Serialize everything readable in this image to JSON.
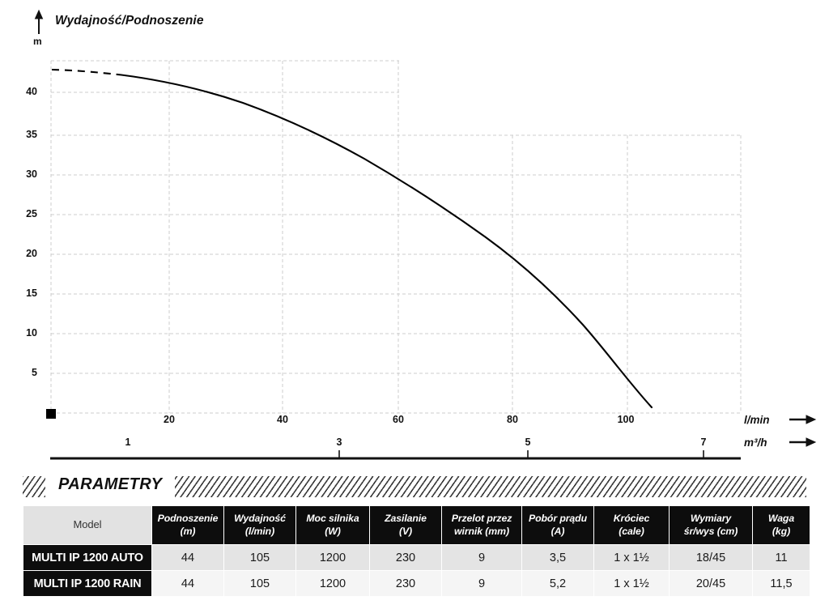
{
  "chart_data": {
    "type": "line",
    "title": "Wydajność/Podnoszenie",
    "ylabel": "m",
    "xlabel": "l/min",
    "xlabel_secondary": "m³/h",
    "ylim": [
      0,
      44
    ],
    "xlim": [
      0,
      117
    ],
    "yticks": [
      5,
      10,
      15,
      20,
      25,
      30,
      35,
      40
    ],
    "xticks": [
      20,
      40,
      60,
      80,
      100
    ],
    "xticks_secondary": [
      1,
      3,
      5,
      7
    ],
    "grid": true,
    "legend": "none",
    "series": [
      {
        "name": "MULTI IP 1200",
        "style": "dashed-then-solid",
        "dash_until_x": 12,
        "x": [
          0,
          5,
          10,
          12,
          15,
          20,
          25,
          30,
          35,
          40,
          45,
          50,
          55,
          60,
          65,
          70,
          75,
          80,
          85,
          90,
          95,
          100,
          105
        ],
        "y": [
          43.0,
          42.8,
          42.4,
          42.2,
          41.7,
          40.7,
          39.5,
          38.1,
          36.5,
          34.8,
          33.0,
          31.0,
          28.9,
          26.7,
          24.4,
          22.0,
          19.6,
          17.2,
          14.5,
          11.5,
          8.2,
          4.5,
          0.3
        ]
      }
    ],
    "origin_marker": "black-square"
  },
  "section": {
    "title": "PARAMETRY"
  },
  "table": {
    "headers": [
      {
        "line1": "Model",
        "line2": ""
      },
      {
        "line1": "Podnoszenie",
        "line2": "(m)"
      },
      {
        "line1": "Wydajność",
        "line2": "(l/min)"
      },
      {
        "line1": "Moc silnika",
        "line2": "(W)"
      },
      {
        "line1": "Zasilanie",
        "line2": "(V)"
      },
      {
        "line1": "Przelot przez",
        "line2": "wirnik (mm)"
      },
      {
        "line1": "Pobór prądu",
        "line2": "(A)"
      },
      {
        "line1": "Króciec",
        "line2": "(cale)"
      },
      {
        "line1": "Wymiary",
        "line2": "śr/wys (cm)"
      },
      {
        "line1": "Waga",
        "line2": "(kg)"
      }
    ],
    "rows": [
      {
        "model": "MULTI IP 1200 AUTO",
        "podnoszenie": "44",
        "wydajnosc": "105",
        "moc": "1200",
        "zasilanie": "230",
        "przelot": "9",
        "pobor": "3,5",
        "krociec": "1 x 1½",
        "wymiary": "18/45",
        "waga": "11"
      },
      {
        "model": "MULTI IP 1200 RAIN",
        "podnoszenie": "44",
        "wydajnosc": "105",
        "moc": "1200",
        "zasilanie": "230",
        "przelot": "9",
        "pobor": "5,2",
        "krociec": "1 x 1½",
        "wymiary": "20/45",
        "waga": "11,5"
      }
    ]
  },
  "colors": {
    "curve": "#000000",
    "grid": "#cccccc",
    "header_bg": "#0d0d0d",
    "model_head_bg": "#e2e2e2",
    "row_a_bg": "#e4e4e4",
    "row_b_bg": "#f5f5f5"
  }
}
